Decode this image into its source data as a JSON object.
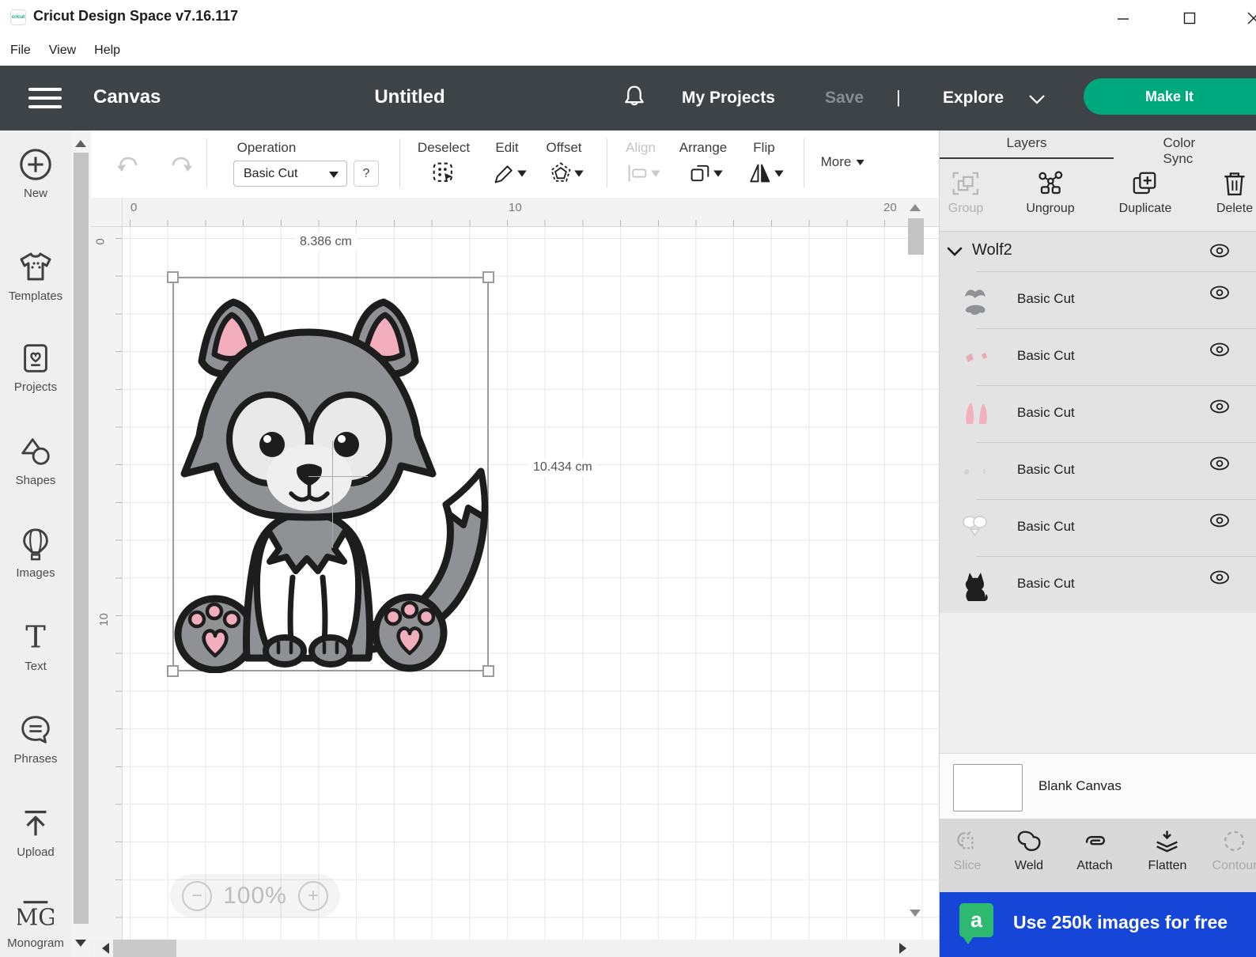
{
  "window": {
    "title": "Cricut Design Space  v7.16.117",
    "logo_text": "cricut"
  },
  "menu": {
    "items": [
      {
        "label": "File"
      },
      {
        "label": "View"
      },
      {
        "label": "Help"
      }
    ]
  },
  "appbar": {
    "canvas_label": "Canvas",
    "project_title": "Untitled",
    "my_projects": "My Projects",
    "save": "Save",
    "divider": "|",
    "explore": "Explore",
    "make_it": "Make It"
  },
  "sidebar": {
    "items": [
      {
        "label": "New"
      },
      {
        "label": "Templates"
      },
      {
        "label": "Projects"
      },
      {
        "label": "Shapes"
      },
      {
        "label": "Images"
      },
      {
        "label": "Text"
      },
      {
        "label": "Phrases"
      },
      {
        "label": "Upload"
      },
      {
        "label": "Monogram"
      }
    ]
  },
  "toolbar": {
    "operation_label": "Operation",
    "operation_value": "Basic Cut",
    "help": "?",
    "deselect": "Deselect",
    "edit": "Edit",
    "offset": "Offset",
    "align": "Align",
    "arrange": "Arrange",
    "flip": "Flip",
    "more": "More"
  },
  "canvas": {
    "ruler_h": [
      "0",
      "10",
      "20"
    ],
    "ruler_v": [
      "0",
      "10"
    ],
    "selection": {
      "width_label": "8.386 cm",
      "height_label": "10.434 cm",
      "content": "cartoon gray wolf clipart"
    },
    "zoom": {
      "minus": "−",
      "value": "100%",
      "plus": "+"
    }
  },
  "layers_panel": {
    "tabs": [
      {
        "label": "Layers",
        "active": true
      },
      {
        "label": "Color Sync",
        "active": false
      }
    ],
    "actions": [
      {
        "label": "Group",
        "disabled": true
      },
      {
        "label": "Ungroup",
        "disabled": false
      },
      {
        "label": "Duplicate",
        "disabled": false
      },
      {
        "label": "Delete",
        "disabled": false
      }
    ],
    "group_name": "Wolf2",
    "layers": [
      {
        "name": "Basic Cut",
        "thumb": "gray-parts"
      },
      {
        "name": "Basic Cut",
        "thumb": "pink-small-parts"
      },
      {
        "name": "Basic Cut",
        "thumb": "pink-ears"
      },
      {
        "name": "Basic Cut",
        "thumb": "light-gray-parts"
      },
      {
        "name": "Basic Cut",
        "thumb": "white-face-parts"
      },
      {
        "name": "Basic Cut",
        "thumb": "black-wolf-silhouette"
      }
    ],
    "blank_canvas": "Blank Canvas",
    "bottom_actions": [
      {
        "label": "Slice",
        "disabled": true
      },
      {
        "label": "Weld",
        "disabled": false
      },
      {
        "label": "Attach",
        "disabled": false
      },
      {
        "label": "Flatten",
        "disabled": false
      },
      {
        "label": "Contour",
        "disabled": true
      }
    ],
    "banner": {
      "logo_letter": "a",
      "text": "Use 250k images for free"
    }
  },
  "colors": {
    "header_dark": "#3d4347",
    "accent_green": "#00a87e",
    "banner_blue": "#1546d7",
    "logo_green": "#2db96f",
    "wolf_gray": "#8f9194",
    "wolf_pink": "#f2aebc",
    "wolf_light": "#e9e9e9"
  }
}
